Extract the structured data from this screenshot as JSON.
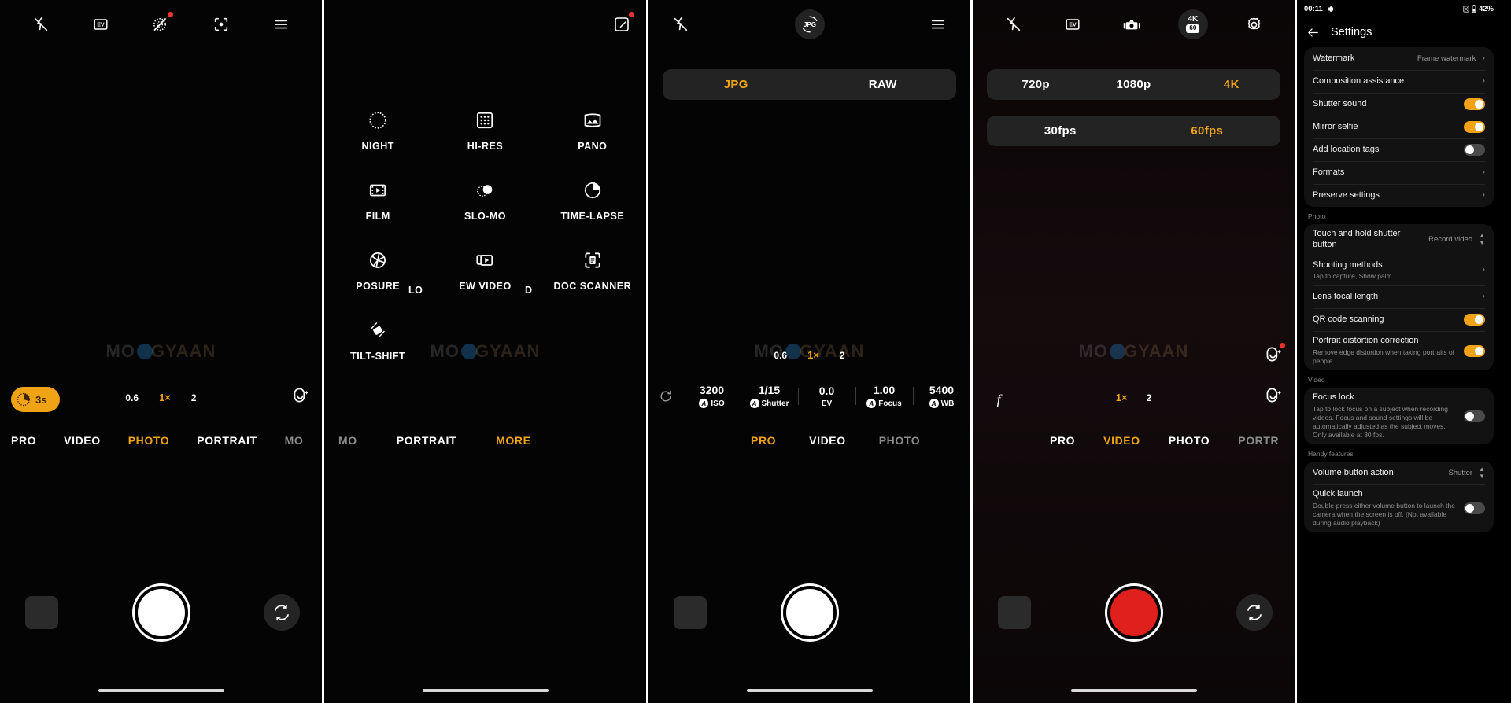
{
  "colors": {
    "accent": "#f0a415",
    "record": "#e0201c",
    "badge": "#e8342a"
  },
  "panel_photo": {
    "top_icons": [
      "flash-off-icon",
      "ev-icon",
      "ai-scene-off-icon",
      "focus-tracking-icon",
      "menu-icon"
    ],
    "timer": "3s",
    "zoom": [
      {
        "label": "0.6",
        "active": false
      },
      {
        "label": "1×",
        "active": true
      },
      {
        "label": "2",
        "active": false
      }
    ],
    "modes": [
      {
        "label": "PRO",
        "active": false,
        "dim": false
      },
      {
        "label": "VIDEO",
        "active": false,
        "dim": false
      },
      {
        "label": "PHOTO",
        "active": true,
        "dim": false
      },
      {
        "label": "PORTRAIT",
        "active": false,
        "dim": false
      },
      {
        "label": "MO",
        "active": false,
        "dim": true
      }
    ]
  },
  "panel_more": {
    "edit_icon": "edit-modes-icon",
    "grid": [
      {
        "label": "NIGHT",
        "icon": "night-icon"
      },
      {
        "label": "HI-RES",
        "icon": "hi-res-icon"
      },
      {
        "label": "PANO",
        "icon": "pano-icon"
      },
      {
        "label": "FILM",
        "icon": "film-icon"
      },
      {
        "label": "SLO-MO",
        "icon": "slo-mo-icon"
      },
      {
        "label": "TIME-LAPSE",
        "icon": "time-lapse-icon"
      },
      {
        "label": "POSURE",
        "icon": "long-exposure-icon"
      },
      {
        "label": "LO",
        "icon": "spacer"
      },
      {
        "label": "EW VIDEO",
        "icon": "preview-video-icon"
      },
      {
        "label": "D",
        "icon": "spacer"
      },
      {
        "label": "DOC SCANNER",
        "icon": "doc-scanner-icon"
      },
      {
        "label": "TILT-SHIFT",
        "icon": "tilt-shift-icon"
      }
    ],
    "modes": [
      {
        "label": "MO",
        "active": false,
        "dim": true
      },
      {
        "label": "PORTRAIT",
        "active": false,
        "dim": false
      },
      {
        "label": "MORE",
        "active": true,
        "dim": false
      }
    ]
  },
  "panel_pro": {
    "top_icons": [
      "flash-off-icon",
      "jpg-format-icon",
      "menu-icon"
    ],
    "format_badge": "JPG",
    "format_options": [
      {
        "label": "JPG",
        "active": true
      },
      {
        "label": "RAW",
        "active": false
      }
    ],
    "zoom": [
      {
        "label": "0.6",
        "active": false
      },
      {
        "label": "1×",
        "active": true
      },
      {
        "label": "2",
        "active": false
      }
    ],
    "pro_controls": [
      {
        "value": "3200",
        "name": "ISO",
        "auto": true
      },
      {
        "value": "1/15",
        "name": "Shutter",
        "auto": true
      },
      {
        "value": "0.0",
        "name": "EV",
        "auto": false
      },
      {
        "value": "1.00",
        "name": "Focus",
        "auto": true
      },
      {
        "value": "5400",
        "name": "WB",
        "auto": true
      }
    ],
    "reset_icon": "reset-icon",
    "modes": [
      {
        "label": "PRO",
        "active": true,
        "dim": false
      },
      {
        "label": "VIDEO",
        "active": false,
        "dim": false
      },
      {
        "label": "PHOTO",
        "active": false,
        "dim": true
      }
    ]
  },
  "panel_video": {
    "top_icons": [
      "flash-off-icon",
      "ev-icon",
      "stabilization-icon",
      "4k60-icon",
      "gear-icon"
    ],
    "quality_badge_top": "4K",
    "quality_badge_bottom": "60",
    "resolution_options": [
      {
        "label": "720p",
        "active": false
      },
      {
        "label": "1080p",
        "active": false
      },
      {
        "label": "4K",
        "active": true
      }
    ],
    "fps_options": [
      {
        "label": "30fps",
        "active": false
      },
      {
        "label": "60fps",
        "active": true
      }
    ],
    "bokeh_icon": "bokeh-f-icon",
    "zoom": [
      {
        "label": "1×",
        "active": true
      },
      {
        "label": "2",
        "active": false
      }
    ],
    "modes": [
      {
        "label": "PRO",
        "active": false,
        "dim": false
      },
      {
        "label": "VIDEO",
        "active": true,
        "dim": false
      },
      {
        "label": "PHOTO",
        "active": false,
        "dim": false
      },
      {
        "label": "PORTR",
        "active": false,
        "dim": true
      }
    ]
  },
  "panel_settings": {
    "status": {
      "time": "00:11",
      "gear_icon": "gear-icon",
      "sim_icon": "sim-icon",
      "battery_icon": "battery-icon",
      "battery": "42%"
    },
    "back_icon": "back-arrow-icon",
    "title": "Settings",
    "groups": [
      {
        "label": "",
        "rows": [
          {
            "title": "Watermark",
            "sub": "",
            "value": "Frame watermark",
            "control": "chevron"
          },
          {
            "title": "Composition assistance",
            "sub": "",
            "value": "",
            "control": "chevron"
          },
          {
            "title": "Shutter sound",
            "sub": "",
            "value": "",
            "control": "toggle-on"
          },
          {
            "title": "Mirror selfie",
            "sub": "",
            "value": "",
            "control": "toggle-on"
          },
          {
            "title": "Add location tags",
            "sub": "",
            "value": "",
            "control": "toggle-off"
          },
          {
            "title": "Formats",
            "sub": "",
            "value": "",
            "control": "chevron"
          },
          {
            "title": "Preserve settings",
            "sub": "",
            "value": "",
            "control": "chevron"
          }
        ]
      },
      {
        "label": "Photo",
        "rows": [
          {
            "title": "Touch and hold shutter button",
            "sub": "",
            "value": "Record video",
            "control": "updown"
          },
          {
            "title": "Shooting methods",
            "sub": "Tap to capture, Show palm",
            "value": "",
            "control": "chevron"
          },
          {
            "title": "Lens focal length",
            "sub": "",
            "value": "",
            "control": "chevron"
          },
          {
            "title": "QR code scanning",
            "sub": "",
            "value": "",
            "control": "toggle-on"
          },
          {
            "title": "Portrait distortion correction",
            "sub": "Remove edge distortion when taking portraits of people.",
            "value": "",
            "control": "toggle-on"
          }
        ]
      },
      {
        "label": "Video",
        "rows": [
          {
            "title": "Focus lock",
            "sub": "Tap to lock focus on a subject when recording videos. Focus and sound settings will be automatically adjusted as the subject moves. Only available at 30 fps.",
            "value": "",
            "control": "toggle-off"
          }
        ]
      },
      {
        "label": "Handy features",
        "rows": [
          {
            "title": "Volume button action",
            "sub": "",
            "value": "Shutter",
            "control": "updown"
          },
          {
            "title": "Quick launch",
            "sub": "Double-press either volume button to launch the camera when the screen is off. (Not available during audio playback)",
            "value": "",
            "control": "toggle-off"
          }
        ]
      }
    ]
  },
  "watermark": {
    "prefix": "MO",
    "middle": "GYAAN",
    "full": "MOBIGYAAN"
  }
}
